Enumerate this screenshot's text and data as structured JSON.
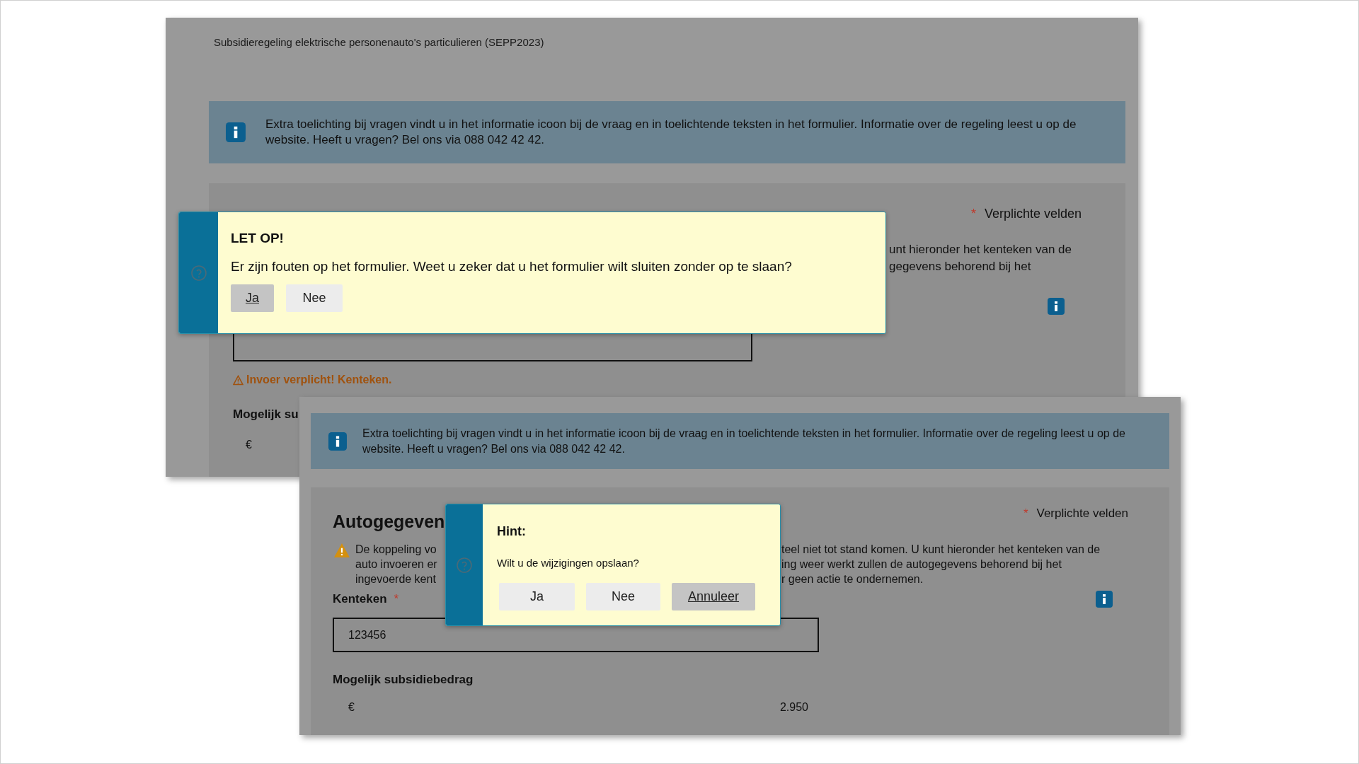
{
  "windows": [
    {
      "title": "Subsidieregeling elektrische personenauto's particulieren (SEPP2023)",
      "info_banner": "Extra toelichting bij vragen vindt u in het informatie icoon bij de vraag en in toelichtende teksten in het formulier. Informatie over de regeling leest u op de website. Heeft u vragen? Bel ons via 088 042 42 42.",
      "required_mark": "*",
      "required_label": "Verplichte velden",
      "intro_fragments": [
        "unt hieronder het kenteken van de",
        "gegevens behorend bij het"
      ],
      "error": "Invoer verplicht! Kenteken.",
      "amount_label": "Mogelijk su",
      "currency": "€",
      "dialog": {
        "title": "LET OP!",
        "message": "Er zijn fouten op het formulier. Weet u zeker dat u het formulier wilt sluiten zonder op te slaan?",
        "buttons": [
          {
            "label": "Ja",
            "selected": true
          },
          {
            "label": "Nee",
            "selected": false
          }
        ]
      }
    },
    {
      "info_banner": "Extra toelichting bij vragen vindt u in het informatie icoon bij de vraag en in toelichtende teksten in het formulier. Informatie over de regeling leest u op de website. Heeft u vragen? Bel ons via 088 042 42 42.",
      "heading": "Autogegeven",
      "required_mark": "*",
      "required_label": "Verplichte velden",
      "warning_left": [
        "De koppeling vo",
        "auto invoeren er",
        "ingevoerde kent"
      ],
      "warning_right": [
        "teel niet tot stand komen. U kunt hieronder het kenteken van de",
        "ing weer werkt zullen de autogegevens behorend bij het",
        "r geen actie te ondernemen."
      ],
      "field_label": "Kenteken",
      "field_mark": "*",
      "field_value": "123456",
      "amount_label": "Mogelijk subsidiebedrag",
      "currency": "€",
      "amount": "2.950",
      "dialog": {
        "title": "Hint:",
        "message": "Wilt u de wijzigingen opslaan?",
        "buttons": [
          {
            "label": "Ja",
            "selected": false
          },
          {
            "label": "Nee",
            "selected": false
          },
          {
            "label": "Annuleer",
            "selected": true
          }
        ]
      }
    }
  ]
}
